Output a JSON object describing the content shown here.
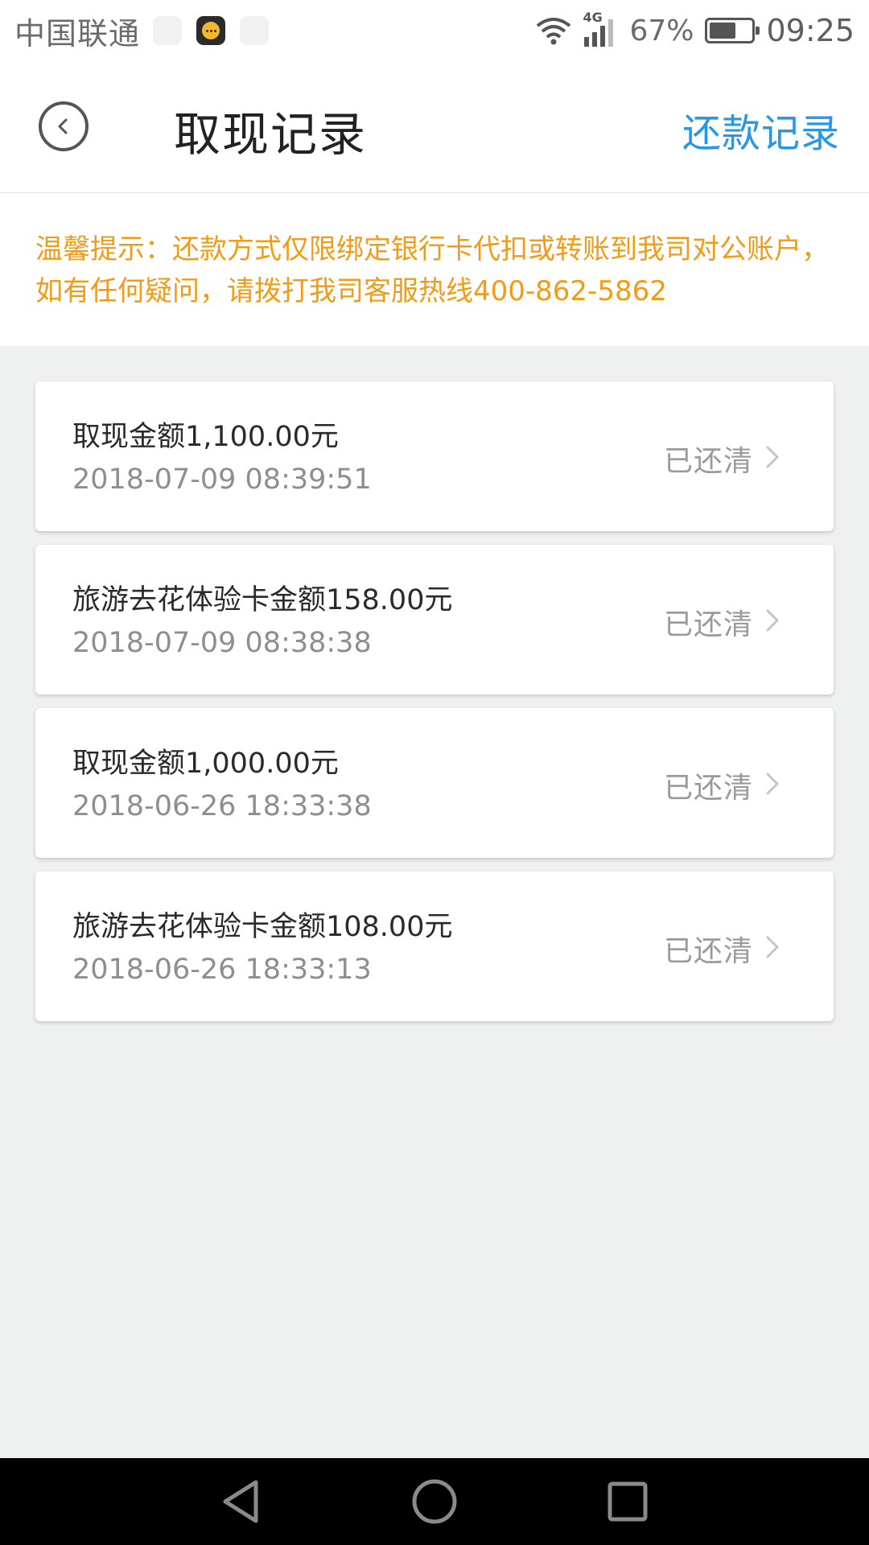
{
  "status_bar": {
    "carrier": "中国联通",
    "network": "4G",
    "battery_percent": "67%",
    "battery_level": 0.67,
    "time": "09:25"
  },
  "header": {
    "title": "取现记录",
    "repay_link": "还款记录",
    "back_icon": "back-circle-icon"
  },
  "notice": {
    "text": "温馨提示：还款方式仅限绑定银行卡代扣或转账到我司对公账户， 如有任何疑问，请拨打我司客服热线400-862-5862"
  },
  "records": [
    {
      "title": "取现金额1,100.00元",
      "time": "2018-07-09 08:39:51",
      "status": "已还清"
    },
    {
      "title": "旅游去花体验卡金额158.00元",
      "time": "2018-07-09 08:38:38",
      "status": "已还清"
    },
    {
      "title": "取现金额1,000.00元",
      "time": "2018-06-26 18:33:38",
      "status": "已还清"
    },
    {
      "title": "旅游去花体验卡金额108.00元",
      "time": "2018-06-26 18:33:13",
      "status": "已还清"
    }
  ],
  "colors": {
    "accent": "#2897ea",
    "notice": "#f39a16",
    "background": "#eff0f0"
  }
}
